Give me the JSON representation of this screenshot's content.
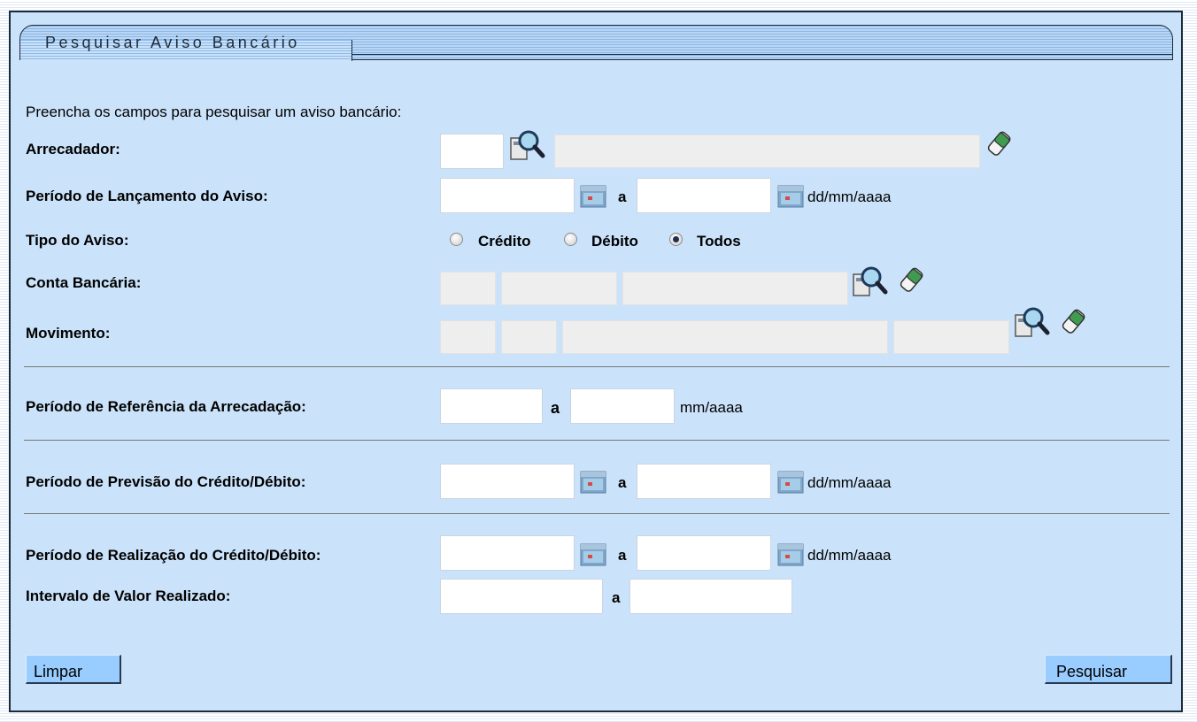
{
  "title": "Pesquisar Aviso Bancário",
  "intro": "Preencha os campos para pesquisar um aviso bancário:",
  "labels": {
    "arrecadador": "Arrecadador:",
    "periodo_lancamento": "Período de Lançamento do Aviso:",
    "tipo_aviso": "Tipo do Aviso:",
    "conta_bancaria": "Conta Bancária:",
    "movimento": "Movimento:",
    "periodo_referencia": "Período de Referência da Arrecadação:",
    "periodo_previsao": "Período de Previsão do Crédito/Débito:",
    "periodo_realizacao": "Período de Realização do Crédito/Débito:",
    "intervalo_valor": "Intervalo de Valor Realizado:"
  },
  "separator": "a",
  "formats": {
    "date": "dd/mm/aaaa",
    "month": "mm/aaaa"
  },
  "radio": {
    "options": [
      "Crédito",
      "Débito",
      "Todos"
    ],
    "selected": "Todos"
  },
  "fields": {
    "arrecadador_codigo": "",
    "arrecadador_nome": "",
    "lancamento_inicio": "",
    "lancamento_fim": "",
    "referencia_inicio": "",
    "referencia_fim": "",
    "previsao_inicio": "",
    "previsao_fim": "",
    "realizacao_inicio": "",
    "realizacao_fim": "",
    "valor_inicio": "",
    "valor_fim": ""
  },
  "buttons": {
    "limpar": "Limpar",
    "pesquisar": "Pesquisar"
  },
  "colors": {
    "panel_bg": "#cbe3fa",
    "button_bg": "#99ccff",
    "readonly_bg": "#eeeeee"
  }
}
